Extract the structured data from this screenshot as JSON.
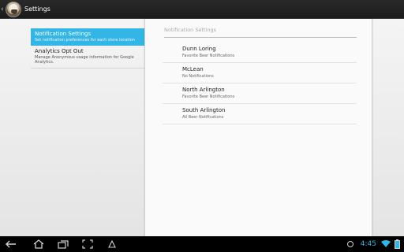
{
  "action_bar": {
    "title": "Settings",
    "up_icon": "chevron-left-icon",
    "app_icon": "app-logo-icon"
  },
  "headers": [
    {
      "title": "Notification Settings",
      "summary": "Set notification preferences for each store location",
      "selected": true
    },
    {
      "title": "Analytics Opt Out",
      "summary": "Manage Anonymous usage information for Google Analytics.",
      "selected": false
    }
  ],
  "detail": {
    "category": "Notification Settings",
    "items": [
      {
        "title": "Dunn Loring",
        "summary": "Favorite Beer Notifications"
      },
      {
        "title": "McLean",
        "summary": "No Notifications"
      },
      {
        "title": "North Arlington",
        "summary": "Favorite Beer Notifications"
      },
      {
        "title": "South Arlington",
        "summary": "All Beer Notifications"
      }
    ]
  },
  "nav_bar": {
    "buttons": [
      "back-icon",
      "home-icon",
      "recent-apps-icon",
      "screenshot-icon",
      "menu-icon"
    ]
  },
  "status": {
    "time": "4:45",
    "accent": "#33b5e5"
  }
}
